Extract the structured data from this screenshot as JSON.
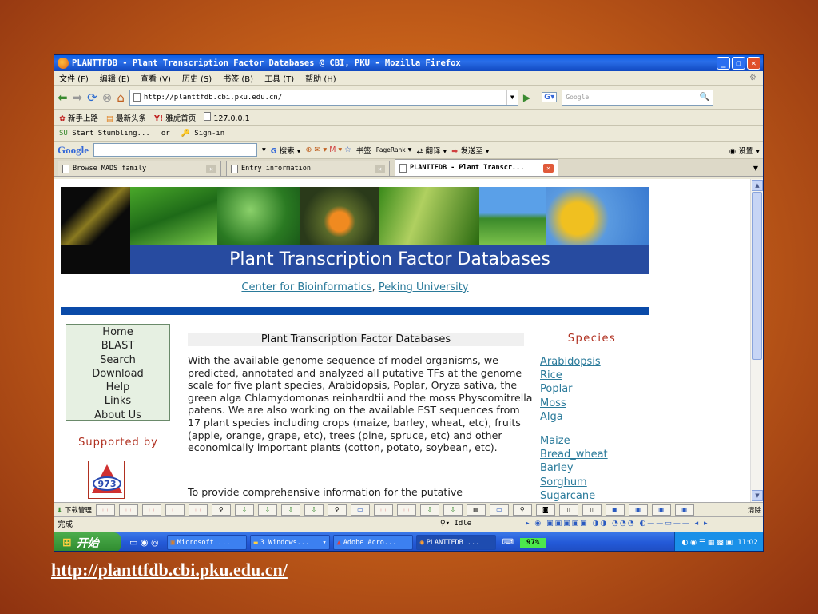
{
  "window": {
    "title": "PLANTTFDB - Plant Transcription Factor Databases @ CBI, PKU - Mozilla Firefox"
  },
  "menu": [
    "文件 (F)",
    "编辑 (E)",
    "查看 (V)",
    "历史 (S)",
    "书签 (B)",
    "工具 (T)",
    "帮助 (H)"
  ],
  "navbar": {
    "url": "http://planttfdb.cbi.pku.edu.cn/",
    "search_placeholder": "Google"
  },
  "bookmarks": [
    "新手上路",
    "最新头条",
    "雅虎首页",
    "127.0.0.1"
  ],
  "stumble": {
    "start": "Start Stumbling...",
    "or": "or",
    "signin": "Sign-in"
  },
  "googlebar": {
    "logo": "Google",
    "search_label": "搜索",
    "bookmarks_label": "书签",
    "pagerank_label": "PageRank",
    "translate_label": "翻译",
    "sendto_label": "发送至",
    "settings_label": "设置"
  },
  "tabs": [
    {
      "label": "Browse MADS family"
    },
    {
      "label": "Entry information"
    },
    {
      "label": "PLANTTFDB - Plant Transcr..."
    }
  ],
  "page": {
    "banner_title": "Plant Transcription Factor Databases",
    "center_link": "Center for Bioinformatics",
    "center_sep": ",",
    "university_link": "Peking University",
    "nav": [
      "Home",
      "BLAST",
      "Search",
      "Download",
      "Help",
      "Links",
      "About Us"
    ],
    "supported_by": "Supported by",
    "main_title": "Plant Transcription Factor Databases",
    "paragraph1": "With the available genome sequence of model organisms, we predicted, annotated and analyzed all putative TFs at the genome scale for five plant species, Arabidopsis, Poplar, Oryza sativa, the green alga Chlamydomonas reinhardtii and the moss Physcomitrella patens. We are also working on the available EST sequences from 17 plant species including crops (maize, barley, wheat, etc), fruits (apple, orange, grape, etc), trees (pine, spruce, etc) and other economically important plants (cotton, potato, soybean, etc).",
    "paragraph2": "To provide comprehensive information for the putative",
    "species_title": "Species",
    "species_group1": [
      "Arabidopsis",
      "Rice",
      "Poplar",
      "Moss",
      "Alga"
    ],
    "species_group2": [
      "Maize",
      "Bread_wheat",
      "Barley",
      "Sorghum",
      "Sugarcane"
    ]
  },
  "statusbar": {
    "left": "完成",
    "idle": "Idle"
  },
  "bottom_toolbar": {
    "left_label": "下载管理",
    "right_label": "清除"
  },
  "taskbar": {
    "start": "开始",
    "tasks": [
      "Microsoft ...",
      "3 Windows...",
      "Adobe Acro...",
      "PLANTTFDB ..."
    ],
    "percent": "97%",
    "clock": "11:02"
  },
  "slide": {
    "caption": "http://planttfdb.cbi.pku.edu.cn/"
  }
}
